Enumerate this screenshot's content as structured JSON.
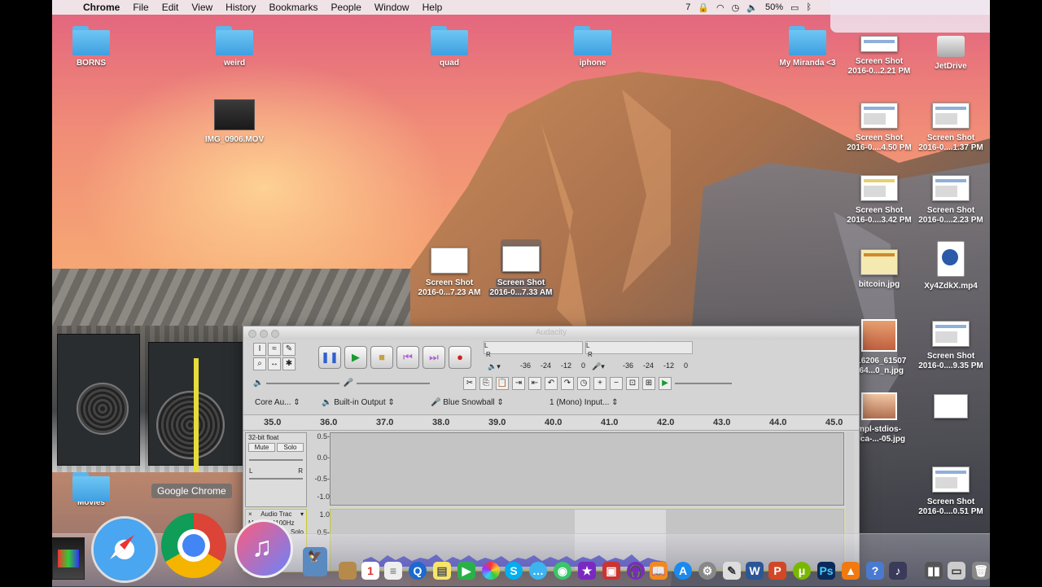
{
  "menubar": {
    "app": "Chrome",
    "items": [
      "File",
      "Edit",
      "View",
      "History",
      "Bookmarks",
      "People",
      "Window",
      "Help"
    ],
    "status": {
      "adobe": "7",
      "battery": "50%"
    }
  },
  "desktop": {
    "folders": [
      {
        "label": "BORNS"
      },
      {
        "label": "weird"
      },
      {
        "label": "quad"
      },
      {
        "label": "iphone"
      },
      {
        "label": "My Miranda <3"
      },
      {
        "label": "Movies"
      }
    ],
    "movie": {
      "label": "IMG_0906.MOV"
    },
    "files": [
      {
        "name": "Screen Shot",
        "date": "2016-0...2.21 PM"
      },
      {
        "name": "JetDrive",
        "date": ""
      },
      {
        "name": "Screen Shot",
        "date": "2016-0....4.50 PM"
      },
      {
        "name": "Screen Shot",
        "date": "2016-0....1.37 PM"
      },
      {
        "name": "Screen Shot",
        "date": "2016-0....3.42 PM"
      },
      {
        "name": "Screen Shot",
        "date": "2016-0....2.23 PM"
      },
      {
        "name": "bitcoin.jpg",
        "date": ""
      },
      {
        "name": "Xy4ZdkX.mp4",
        "date": ""
      },
      {
        "name": "516206_61507",
        "date": "864...0_n.jpg"
      },
      {
        "name": "Screen Shot",
        "date": "2016-0....9.35 PM"
      },
      {
        "name": "mpl-stdios-",
        "date": "nica-...-05.jpg"
      },
      {
        "name": "Screen Shot",
        "date": "2016-0....0.51 PM"
      },
      {
        "name": "Screen Shot",
        "date": "2016-0...7.23 AM"
      },
      {
        "name": "Screen Shot",
        "date": "2016-0...7.33 AM"
      }
    ]
  },
  "tooltip": "Google Chrome",
  "audacity": {
    "title": "Audacity",
    "meter_ticks": [
      "-36",
      "-24",
      "-12",
      "0"
    ],
    "meter_ticks_right": [
      "-36",
      "-24",
      "-12",
      "0"
    ],
    "meter_L": "L",
    "meter_R": "R",
    "host": "Core Au...",
    "output": "Built-in Output",
    "input": "Blue Snowball",
    "channels": "1 (Mono) Input...",
    "ruler": [
      "35.0",
      "36.0",
      "37.0",
      "38.0",
      "39.0",
      "40.0",
      "41.0",
      "42.0",
      "43.0",
      "44.0",
      "45.0"
    ],
    "track1": {
      "format": "32-bit float",
      "mute": "Mute",
      "solo": "Solo",
      "l": "L",
      "r": "R",
      "yaxis": [
        "0.5-",
        "0.0-",
        "-0.5-",
        "-1.0"
      ]
    },
    "track2": {
      "name": "Audio Trac",
      "info": "Mono, 44100Hz",
      "solo": "Solo",
      "yaxis": [
        "1.0",
        "0.5-"
      ]
    },
    "colors": {
      "wave": "#3b3bd0",
      "selection": "#ffffff"
    }
  }
}
